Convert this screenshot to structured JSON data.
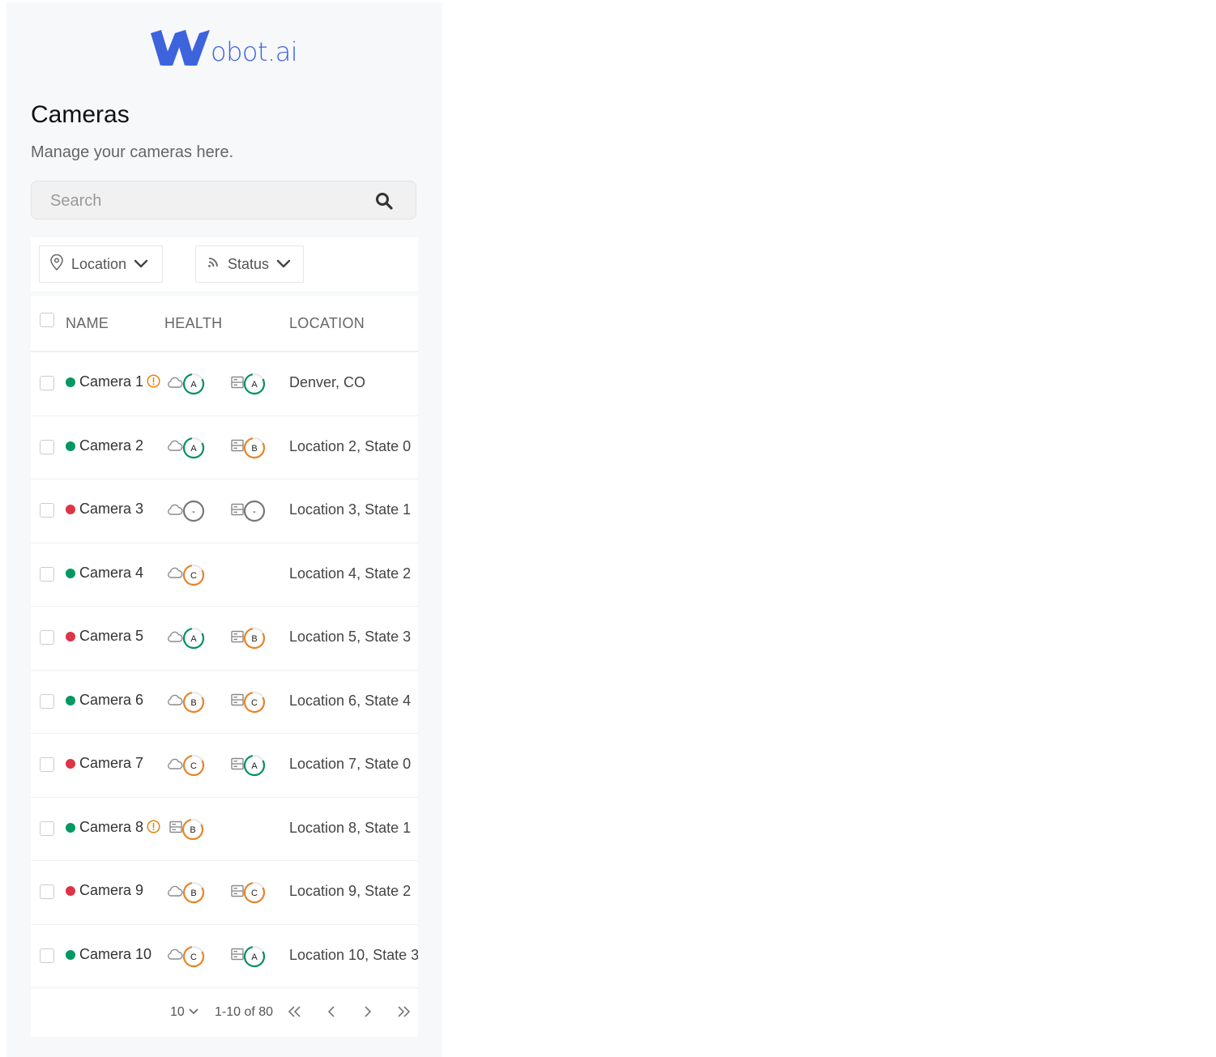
{
  "brand": {
    "logo_text": "obot.ai",
    "color": "#3d63dd"
  },
  "page": {
    "title": "Cameras",
    "subtitle": "Manage your cameras here."
  },
  "search": {
    "placeholder": "Search",
    "value": "",
    "icon": "search-icon"
  },
  "filters": [
    {
      "label": "Location",
      "icon": "map-pin-icon"
    },
    {
      "label": "Status",
      "icon": "rss-icon"
    }
  ],
  "table": {
    "headers": {
      "name": "NAME",
      "health": "HEALTH",
      "location": "LOCATION"
    },
    "rows": [
      {
        "name": "Camera 1",
        "status": "online",
        "warning": true,
        "cloud": "A",
        "storage": "A",
        "location": "Denver, CO"
      },
      {
        "name": "Camera 2",
        "status": "online",
        "warning": false,
        "cloud": "A",
        "storage": "B",
        "location": "Location 2, State 0"
      },
      {
        "name": "Camera 3",
        "status": "offline",
        "warning": false,
        "cloud": "-",
        "storage": "-",
        "location": "Location 3, State 1"
      },
      {
        "name": "Camera 4",
        "status": "online",
        "warning": false,
        "cloud": "C",
        "storage": null,
        "location": "Location 4, State 2"
      },
      {
        "name": "Camera 5",
        "status": "offline",
        "warning": false,
        "cloud": "A",
        "storage": "B",
        "location": "Location 5, State 3"
      },
      {
        "name": "Camera 6",
        "status": "online",
        "warning": false,
        "cloud": "B",
        "storage": "C",
        "location": "Location 6, State 4"
      },
      {
        "name": "Camera 7",
        "status": "offline",
        "warning": false,
        "cloud": "C",
        "storage": "A",
        "location": "Location 7, State 0"
      },
      {
        "name": "Camera 8",
        "status": "online",
        "warning": true,
        "cloud": null,
        "storage": "B",
        "location": "Location 8, State 1"
      },
      {
        "name": "Camera 9",
        "status": "offline",
        "warning": false,
        "cloud": "B",
        "storage": "C",
        "location": "Location 9, State 2"
      },
      {
        "name": "Camera 10",
        "status": "online",
        "warning": false,
        "cloud": "C",
        "storage": "A",
        "location": "Location 10, State 3"
      }
    ]
  },
  "pagination": {
    "rows_per_page": "10",
    "range": "1-10 of 80"
  },
  "colors": {
    "online": "#029861",
    "offline": "#dc3545",
    "warning": "#e8830d",
    "grade_A": "#039161",
    "grade_B": "#e8842a",
    "grade_C": "#e8842a",
    "grade_none": "#777777"
  }
}
